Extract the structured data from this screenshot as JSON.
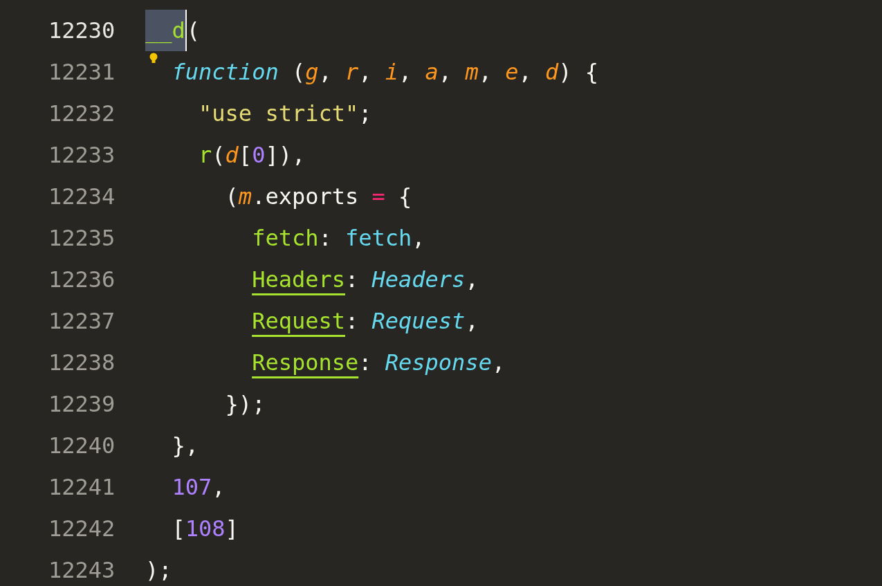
{
  "editor": {
    "lines": [
      {
        "number": "12230",
        "current": true,
        "hint": false,
        "tokens": [
          {
            "kind": "selection",
            "text": "__d"
          },
          {
            "kind": "caret"
          },
          {
            "kind": "plain",
            "text": "("
          }
        ]
      },
      {
        "number": "12231",
        "current": false,
        "hint": true,
        "tokens": [
          {
            "kind": "keyword",
            "text": "  function"
          },
          {
            "kind": "plain",
            "text": " ("
          },
          {
            "kind": "param",
            "text": "g"
          },
          {
            "kind": "plain",
            "text": ", "
          },
          {
            "kind": "param",
            "text": "r"
          },
          {
            "kind": "plain",
            "text": ", "
          },
          {
            "kind": "param",
            "text": "i"
          },
          {
            "kind": "plain",
            "text": ", "
          },
          {
            "kind": "param",
            "text": "a"
          },
          {
            "kind": "plain",
            "text": ", "
          },
          {
            "kind": "param",
            "text": "m"
          },
          {
            "kind": "plain",
            "text": ", "
          },
          {
            "kind": "param",
            "text": "e"
          },
          {
            "kind": "plain",
            "text": ", "
          },
          {
            "kind": "param",
            "text": "d"
          },
          {
            "kind": "plain",
            "text": ") {"
          }
        ]
      },
      {
        "number": "12232",
        "current": false,
        "hint": false,
        "tokens": [
          {
            "kind": "string",
            "text": "    \"use strict\""
          },
          {
            "kind": "plain",
            "text": ";"
          }
        ]
      },
      {
        "number": "12233",
        "current": false,
        "hint": false,
        "tokens": [
          {
            "kind": "func",
            "text": "    r"
          },
          {
            "kind": "plain",
            "text": "("
          },
          {
            "kind": "param",
            "text": "d"
          },
          {
            "kind": "plain",
            "text": "["
          },
          {
            "kind": "number",
            "text": "0"
          },
          {
            "kind": "plain",
            "text": "]),"
          }
        ]
      },
      {
        "number": "12234",
        "current": false,
        "hint": false,
        "tokens": [
          {
            "kind": "plain",
            "text": "      ("
          },
          {
            "kind": "param",
            "text": "m"
          },
          {
            "kind": "plain",
            "text": ".exports "
          },
          {
            "kind": "operator",
            "text": "="
          },
          {
            "kind": "plain",
            "text": " {"
          }
        ]
      },
      {
        "number": "12235",
        "current": false,
        "hint": false,
        "tokens": [
          {
            "kind": "func",
            "text": "        fetch"
          },
          {
            "kind": "plain",
            "text": ": "
          },
          {
            "kind": "value",
            "text": "fetch"
          },
          {
            "kind": "plain",
            "text": ","
          }
        ]
      },
      {
        "number": "12236",
        "current": false,
        "hint": false,
        "tokens": [
          {
            "kind": "underlined",
            "text": "        Headers"
          },
          {
            "kind": "plain",
            "text": ": "
          },
          {
            "kind": "type",
            "text": "Headers"
          },
          {
            "kind": "plain",
            "text": ","
          }
        ]
      },
      {
        "number": "12237",
        "current": false,
        "hint": false,
        "tokens": [
          {
            "kind": "underlined",
            "text": "        Request"
          },
          {
            "kind": "plain",
            "text": ": "
          },
          {
            "kind": "type",
            "text": "Request"
          },
          {
            "kind": "plain",
            "text": ","
          }
        ]
      },
      {
        "number": "12238",
        "current": false,
        "hint": false,
        "tokens": [
          {
            "kind": "underlined",
            "text": "        Response"
          },
          {
            "kind": "plain",
            "text": ": "
          },
          {
            "kind": "type",
            "text": "Response"
          },
          {
            "kind": "plain",
            "text": ","
          }
        ]
      },
      {
        "number": "12239",
        "current": false,
        "hint": false,
        "tokens": [
          {
            "kind": "plain",
            "text": "      });"
          }
        ]
      },
      {
        "number": "12240",
        "current": false,
        "hint": false,
        "tokens": [
          {
            "kind": "plain",
            "text": "  },"
          }
        ]
      },
      {
        "number": "12241",
        "current": false,
        "hint": false,
        "tokens": [
          {
            "kind": "number",
            "text": "  107"
          },
          {
            "kind": "plain",
            "text": ","
          }
        ]
      },
      {
        "number": "12242",
        "current": false,
        "hint": false,
        "tokens": [
          {
            "kind": "plain",
            "text": "  ["
          },
          {
            "kind": "number",
            "text": "108"
          },
          {
            "kind": "plain",
            "text": "]"
          }
        ]
      },
      {
        "number": "12243",
        "current": false,
        "hint": false,
        "tokens": [
          {
            "kind": "plain",
            "text": ");"
          }
        ]
      }
    ]
  }
}
